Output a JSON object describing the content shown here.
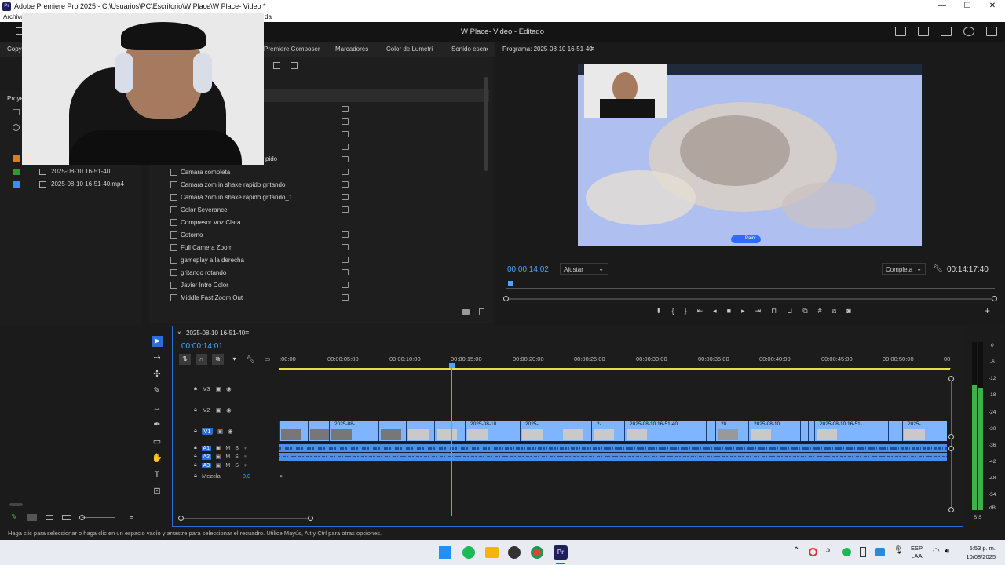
{
  "window": {
    "title": "Adobe Premiere Pro 2025 - C:\\Usuarios\\PC\\Escritorio\\W Place\\W Place- Video *",
    "menu": [
      "Archivo",
      "da"
    ]
  },
  "header": {
    "project_title": "W Place- Video",
    "status": " - Editado"
  },
  "workspace_tabs": [
    "Copy",
    "Premiere Composer",
    "Marcadores",
    "Color de Lumetri",
    "Sonido esen"
  ],
  "project_panel": {
    "title": "Proye",
    "items": [
      {
        "name": "2025-08-10 16-51-40",
        "color": "#2d9a3a"
      },
      {
        "name": "2025-08-10 16-51-40.mp4",
        "color": "#3b8cff"
      }
    ],
    "orange_label": "#e07b1a"
  },
  "effects_panel": {
    "partial_item": "pido",
    "items": [
      "Camara completa",
      "Camara zom in shake rapido gritando",
      "Camara zom in shake rapido gritando_1",
      "Color Severance",
      "Compresor Voz Clara",
      "Cotorno",
      "Full Camera Zoom",
      "gameplay a la derecha",
      "gritando rotando",
      "Javier Intro Color",
      "Middle Fast Zoom Out"
    ]
  },
  "program_monitor": {
    "title": "Programa: 2025-08-10 16-51-40",
    "current_time": "00:00:14:02",
    "fit": "Ajustar",
    "quality": "Completa",
    "duration": "00:14:17:40",
    "paint_label": "Paint"
  },
  "timeline": {
    "sequence_name": "2025-08-10 16-51-40",
    "timecode": "00:00:14:01",
    "ruler": [
      ":00:00",
      "00:00:05:00",
      "00:00:10:00",
      "00:00:15:00",
      "00:00:20:00",
      "00:00:25:00",
      "00:00:30:00",
      "00:00:35:00",
      "00:00:40:00",
      "00:00:45:00",
      "00:00:50:00",
      "00"
    ],
    "video_tracks": [
      "V3",
      "V2",
      "V1"
    ],
    "audio_tracks": [
      "A1",
      "A2",
      "A3"
    ],
    "mix_label": "Mezcla",
    "mix_value": "0,0",
    "clip_labels": [
      "2025-08-",
      "2025-08-10",
      "2025-",
      "2-",
      "2025-08-10 16-51-40",
      "20",
      "2025-08-10",
      "2025-08-10 16-51-",
      "2025-"
    ]
  },
  "meters": {
    "scale": [
      "0",
      "-6",
      "-12",
      "-18",
      "-24",
      "-30",
      "-36",
      "-42",
      "-48",
      "-54",
      "dB"
    ],
    "solo": "S  S"
  },
  "status_bar": {
    "hint": "Haga clic para seleccionar o haga clic en un espacio vacío y arrastre para seleccionar el recuadro. Utilice Mayús, Alt y Ctrl para otras opciones."
  },
  "taskbar": {
    "lang": "ESP",
    "lang_sub": "LAA",
    "time": "5:53 p. m.",
    "date": "10/08/2025"
  }
}
